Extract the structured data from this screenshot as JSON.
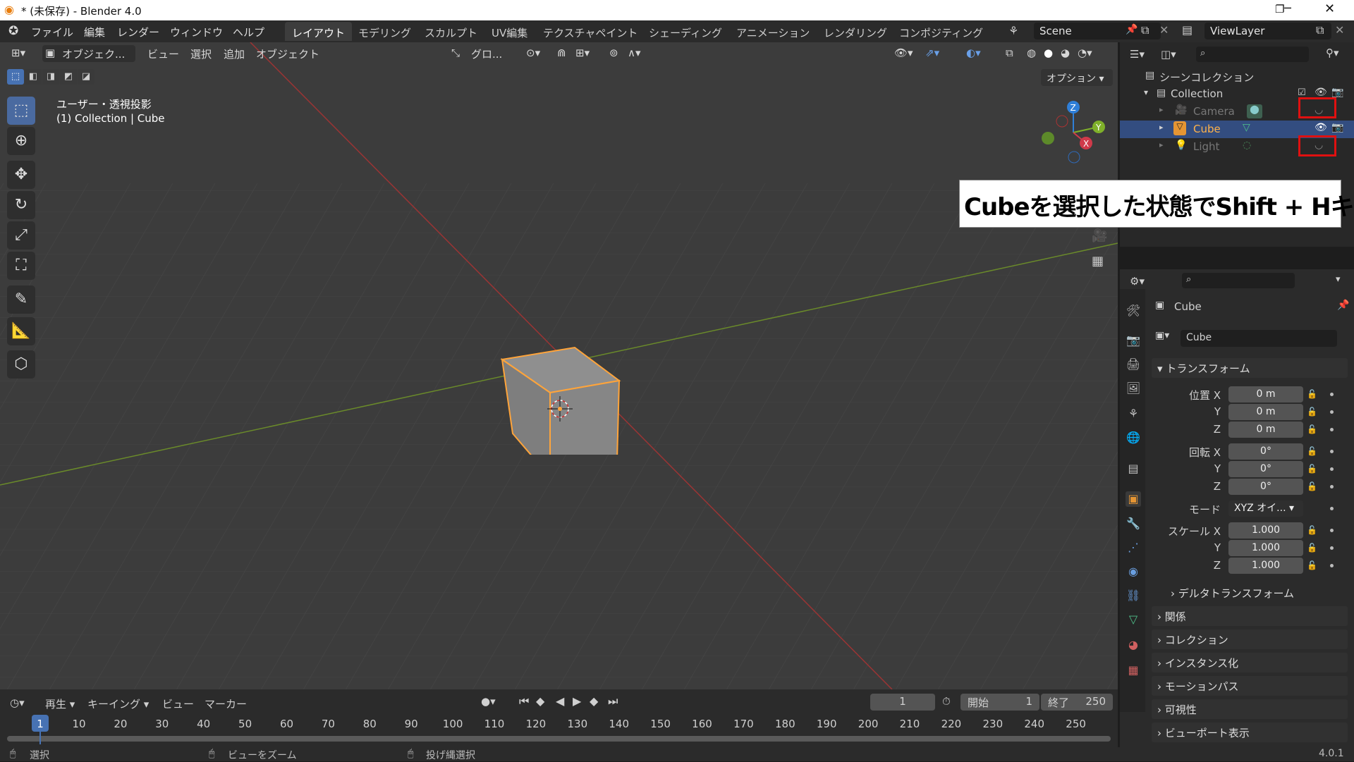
{
  "window": {
    "title": "* (未保存) - Blender 4.0"
  },
  "menu": [
    "ファイル",
    "編集",
    "レンダー",
    "ウィンドウ",
    "ヘルプ"
  ],
  "workspaces": [
    "レイアウト",
    "モデリング",
    "スカルプト",
    "UV編集",
    "テクスチャペイント",
    "シェーディング",
    "アニメーション",
    "レンダリング",
    "コンポジティング"
  ],
  "scene": {
    "name": "Scene",
    "view_layer": "ViewLayer"
  },
  "viewport_header": {
    "mode": "オブジェク...",
    "view": "ビュー",
    "select": "選択",
    "add": "追加",
    "object": "オブジェクト",
    "transform": "グロ...",
    "options": "オプション"
  },
  "viewport": {
    "projection": "ユーザー・透視投影",
    "context": "(1) Collection | Cube"
  },
  "outliner": {
    "scene_collection": "シーンコレクション",
    "collection": "Collection",
    "items": [
      "Camera",
      "Cube",
      "Light"
    ]
  },
  "annotation": "Cubeを選択した状態でShift + Hキー",
  "properties": {
    "object_name": "Cube",
    "data_name": "Cube",
    "transform_header": "トランスフォーム",
    "location_label": "位置 X",
    "rotation_label": "回転 X",
    "scale_label": "スケール X",
    "mode_label": "モード",
    "mode_value": "XYZ オイ...",
    "y_label": "Y",
    "z_label": "Z",
    "location": [
      "0 m",
      "0 m",
      "0 m"
    ],
    "rotation": [
      "0°",
      "0°",
      "0°"
    ],
    "scale": [
      "1.000",
      "1.000",
      "1.000"
    ],
    "delta": "デルタトランスフォーム",
    "panels": [
      "関係",
      "コレクション",
      "インスタンス化",
      "モーションパス",
      "可視性",
      "ビューポート表示"
    ]
  },
  "timeline": {
    "playback": "再生",
    "keying": "キーイング",
    "view": "ビュー",
    "marker": "マーカー",
    "current_frame": "1",
    "start_label": "開始",
    "start": "1",
    "end_label": "終了",
    "end": "250",
    "ticks": [
      "1",
      "10",
      "20",
      "30",
      "40",
      "50",
      "60",
      "70",
      "80",
      "90",
      "100",
      "110",
      "120",
      "130",
      "140",
      "150",
      "160",
      "170",
      "180",
      "190",
      "200",
      "210",
      "220",
      "230",
      "240",
      "250"
    ]
  },
  "status": {
    "select": "選択",
    "zoom": "ビューをズーム",
    "lasso": "投げ縄選択",
    "version": "4.0.1"
  },
  "colors": {
    "accent": "#4772b3",
    "selection": "#ff9a2e",
    "annotation_box": "#e01010"
  }
}
